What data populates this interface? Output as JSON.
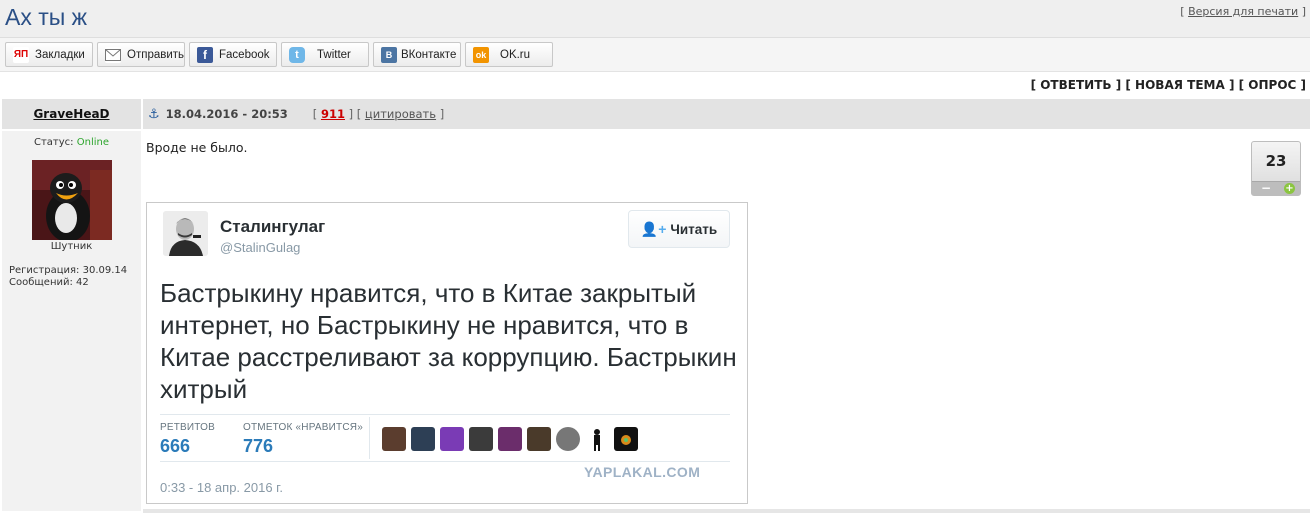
{
  "topic": {
    "title": "Ах ты ж",
    "print_label": "Версия для печати"
  },
  "share": [
    {
      "label": "Закладки",
      "icon": "yandex-bookmarks-icon"
    },
    {
      "label": "Отправить",
      "icon": "envelope-icon"
    },
    {
      "label": "Facebook",
      "icon": "facebook-icon"
    },
    {
      "label": "Twitter",
      "icon": "twitter-icon"
    },
    {
      "label": "ВКонтакте",
      "icon": "vkontakte-icon"
    },
    {
      "label": "OK.ru",
      "icon": "odnoklassniki-icon"
    }
  ],
  "actions": {
    "reply": "ОТВЕТИТЬ",
    "new_topic": "НОВАЯ ТЕМА",
    "poll": "ОПРОС"
  },
  "post": {
    "author": "GraveHeaD",
    "date": "18.04.2016 - 20:53",
    "number": "911",
    "quote_label": "цитировать",
    "text": "Вроде не было.",
    "rating": "23"
  },
  "user": {
    "status_label": "Статус:",
    "status_value": "Online",
    "rank": "Шутник",
    "registration": "Регистрация: 30.09.14",
    "messages": "Сообщений: 42"
  },
  "tweet": {
    "name": "Сталингулаг",
    "handle": "@StalinGulag",
    "follow_label": "Читать",
    "text": "Бастрыкину нравится, что в Китае закрытый интернет, но Бастрыкину не нравится, что в Китае расстреливают за коррупцию. Бастрыкин хитрый",
    "retweets_label": "РЕТВИТОВ",
    "retweets_value": "666",
    "likes_label": "ОТМЕТОК «НРАВИТСЯ»",
    "likes_value": "776",
    "timestamp": "0:33 - 18 апр. 2016 г.",
    "watermark": "YAPLAKAL.COM"
  },
  "colors": {
    "title": "#2a4f86",
    "status_online": "#2da52d",
    "post_number": "#cc0000",
    "tweet_stat": "#2b7bb9"
  }
}
